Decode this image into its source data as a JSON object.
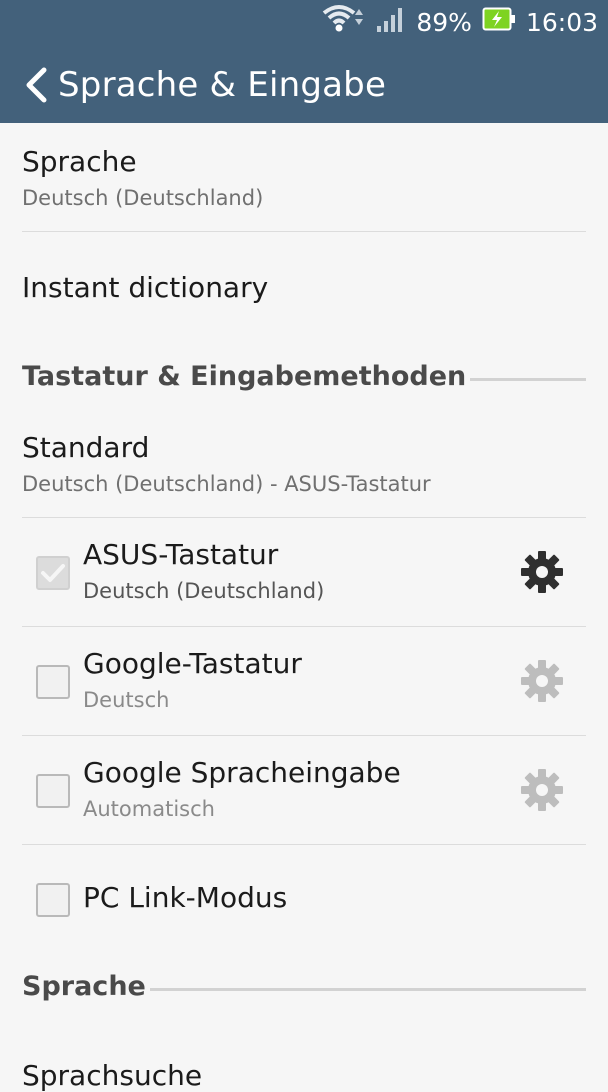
{
  "status_bar": {
    "battery_percent": "89%",
    "time": "16:03"
  },
  "header": {
    "title": "Sprache & Eingabe"
  },
  "items": {
    "sprache": {
      "title": "Sprache",
      "subtitle": "Deutsch (Deutschland)"
    },
    "instant": {
      "title": "Instant dictionary"
    },
    "section_keyboard": "Tastatur & Eingabemethoden",
    "standard": {
      "title": "Standard",
      "subtitle": "Deutsch (Deutschland) - ASUS-Tastatur"
    },
    "asus": {
      "title": "ASUS-Tastatur",
      "subtitle": "Deutsch (Deutschland)",
      "checked": true
    },
    "google_kb": {
      "title": "Google-Tastatur",
      "subtitle": "Deutsch",
      "checked": false
    },
    "google_voice": {
      "title": "Google Spracheingabe",
      "subtitle": "Automatisch",
      "checked": false
    },
    "pclink": {
      "title": "PC Link-Modus",
      "checked": false
    },
    "section_speech": "Sprache",
    "sprachsuche": {
      "title": "Sprachsuche"
    }
  },
  "colors": {
    "appbar": "#43617b",
    "battery": "#7ed321"
  }
}
